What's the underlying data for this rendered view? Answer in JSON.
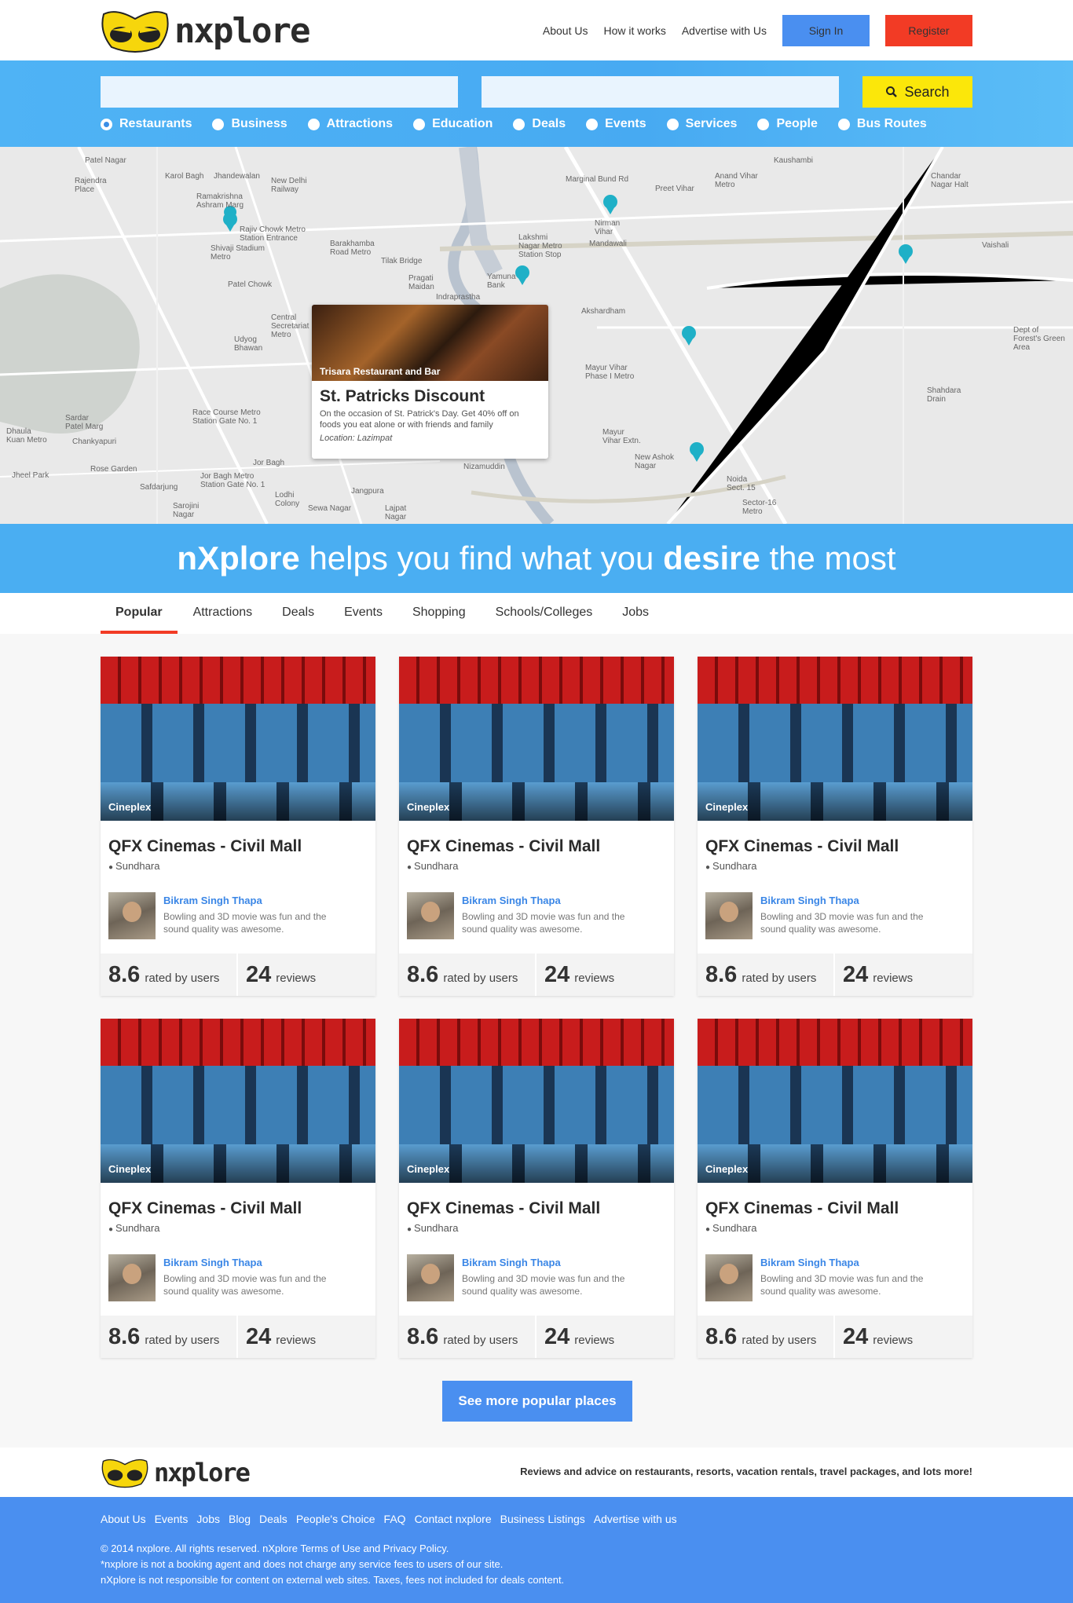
{
  "brand": {
    "name": "nxplore"
  },
  "topnav": {
    "links": [
      "About Us",
      "How it works",
      "Advertise with Us"
    ],
    "signin_label": "Sign In",
    "register_label": "Register"
  },
  "search": {
    "button_label": "Search",
    "categories": [
      {
        "label": "Restaurants",
        "selected": true
      },
      {
        "label": "Business",
        "selected": false
      },
      {
        "label": "Attractions",
        "selected": false
      },
      {
        "label": "Education",
        "selected": false
      },
      {
        "label": "Deals",
        "selected": false
      },
      {
        "label": "Events",
        "selected": false
      },
      {
        "label": "Services",
        "selected": false
      },
      {
        "label": "People",
        "selected": false
      },
      {
        "label": "Bus Routes",
        "selected": false
      }
    ]
  },
  "map": {
    "labels": [
      "Patel Nagar",
      "Karol Bagh",
      "Jhandewalan",
      "New Delhi Railway",
      "Rajendra Place",
      "Ramakrishna Ashram Marg",
      "Rajiv Chowk Metro Station Entrance",
      "Shivaji Stadium Metro",
      "Barakhamba Road Metro",
      "Patel Chowk",
      "Udyog Bhawan",
      "Central Secretariat Metro",
      "Tilak Bridge",
      "Pragati Maidan",
      "Indraprastha",
      "Yamuna Bank",
      "Lakshmi Nagar Metro Station Stop",
      "Nirman Vihar",
      "Mandawali",
      "Preet Vihar",
      "Anand Vihar Metro",
      "Kaushambi",
      "Akshardham",
      "Mayur Vihar Phase I Metro",
      "Mayur Vihar Extn.",
      "New Ashok Nagar",
      "Noida Sect. 15",
      "Sector-16 Metro",
      "Race Course Metro Station Gate No. 1",
      "Sardar Patel Marg",
      "Chankyapuri",
      "Dhaula Kuan Metro",
      "Jheel Park",
      "Rose Garden",
      "Jor Bagh",
      "Jor Bagh Metro Station Gate No. 1",
      "Lodhi Colony",
      "Sewa Nagar",
      "Jangpura",
      "Nizamuddin",
      "Safdarjung",
      "Sarojini Nagar",
      "Lajpat Nagar",
      "Marginal Bund Rd",
      "Dept of Forest's Green Area",
      "Chandar Nagar Halt",
      "Vaishali",
      "Shahdara Drain"
    ],
    "popup": {
      "venue": "Trisara Restaurant and Bar",
      "title": "St. Patricks Discount",
      "description": "On the occasion of St. Patrick's Day. Get 40% off on foods you eat alone or with friends and family",
      "location": "Location: Lazimpat"
    }
  },
  "tagline": {
    "brand": "nXplore",
    "mid": "helps you find what you",
    "strong": "desire",
    "end": "the most"
  },
  "tabs": [
    "Popular",
    "Attractions",
    "Deals",
    "Events",
    "Shopping",
    "Schools/Colleges",
    "Jobs"
  ],
  "cards": [
    {
      "category": "Cineplex",
      "title": "QFX Cinemas - Civil Mall",
      "location": "Sundhara",
      "reviewer": "Bikram Singh Thapa",
      "review": "Bowling and 3D movie was fun and the sound quality was awesome.",
      "rating": "8.6",
      "rating_label": "rated by users",
      "reviews": "24",
      "reviews_label": "reviews"
    },
    {
      "category": "Cineplex",
      "title": "QFX Cinemas - Civil Mall",
      "location": "Sundhara",
      "reviewer": "Bikram Singh Thapa",
      "review": "Bowling and 3D movie was fun and the sound quality was awesome.",
      "rating": "8.6",
      "rating_label": "rated by users",
      "reviews": "24",
      "reviews_label": "reviews"
    },
    {
      "category": "Cineplex",
      "title": "QFX Cinemas - Civil Mall",
      "location": "Sundhara",
      "reviewer": "Bikram Singh Thapa",
      "review": "Bowling and 3D movie was fun and the sound quality was awesome.",
      "rating": "8.6",
      "rating_label": "rated by users",
      "reviews": "24",
      "reviews_label": "reviews"
    },
    {
      "category": "Cineplex",
      "title": "QFX Cinemas - Civil Mall",
      "location": "Sundhara",
      "reviewer": "Bikram Singh Thapa",
      "review": "Bowling and 3D movie was fun and the sound quality was awesome.",
      "rating": "8.6",
      "rating_label": "rated by users",
      "reviews": "24",
      "reviews_label": "reviews"
    },
    {
      "category": "Cineplex",
      "title": "QFX Cinemas - Civil Mall",
      "location": "Sundhara",
      "reviewer": "Bikram Singh Thapa",
      "review": "Bowling and 3D movie was fun and the sound quality was awesome.",
      "rating": "8.6",
      "rating_label": "rated by users",
      "reviews": "24",
      "reviews_label": "reviews"
    },
    {
      "category": "Cineplex",
      "title": "QFX Cinemas - Civil Mall",
      "location": "Sundhara",
      "reviewer": "Bikram Singh Thapa",
      "review": "Bowling and 3D movie was fun and the sound quality was awesome.",
      "rating": "8.6",
      "rating_label": "rated by users",
      "reviews": "24",
      "reviews_label": "reviews"
    }
  ],
  "more_label": "See more popular places",
  "footer": {
    "tagline": "Reviews and advice on restaurants, resorts, vacation rentals, travel packages, and lots more!",
    "links": [
      "About Us",
      "Events",
      "Jobs",
      "Blog",
      "Deals",
      "People's Choice",
      "FAQ",
      "Contact nxplore",
      "Business Listings",
      "Advertise with us"
    ],
    "copyright": "© 2014 nxplore. All rights reserved. nXplore Terms of Use and Privacy Policy.",
    "note1": "*nxplore is not a booking agent and does not charge any service fees to users of our site.",
    "note2": "nXplore  is not responsible for content on external web sites. Taxes, fees not included for deals content."
  },
  "colors": {
    "primary": "#4a8ff0",
    "accent": "#f23b25",
    "search": "#fbe70a",
    "band": "#4aaef2"
  }
}
